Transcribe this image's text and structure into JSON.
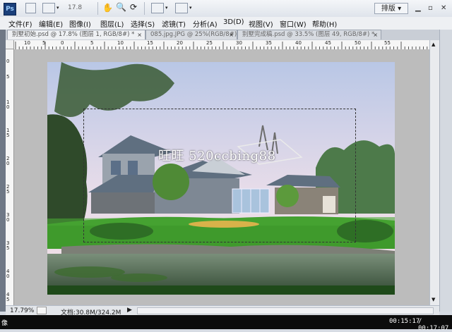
{
  "app": {
    "logo_text": "Ps",
    "zoom_value": "17.8",
    "layout_button": "排版"
  },
  "menu": [
    {
      "label": "文件(F)"
    },
    {
      "label": "编辑(E)"
    },
    {
      "label": "图像(I)"
    },
    {
      "label": "图层(L)"
    },
    {
      "label": "选择(S)"
    },
    {
      "label": "滤镜(T)"
    },
    {
      "label": "分析(A)"
    },
    {
      "label": "3D(D)"
    },
    {
      "label": "视图(V)"
    },
    {
      "label": "窗口(W)"
    },
    {
      "label": "帮助(H)"
    }
  ],
  "tabs": [
    {
      "label": "别墅初始.psd @ 17.8% (图层 1, RGB/8#) *",
      "close": "×"
    },
    {
      "label": "085.jpg.JPG @ 25%(RGB/8#)",
      "close": "×"
    },
    {
      "label": "别墅完成稿.psd @ 33.5% (图层 49, RGB/8#) *",
      "close": "×"
    }
  ],
  "ruler_h": [
    "10",
    "5",
    "0",
    "5",
    "10",
    "15",
    "20",
    "25",
    "30",
    "35",
    "40",
    "45",
    "50",
    "55"
  ],
  "ruler_v": [
    "0",
    "5",
    "10",
    "15",
    "20",
    "25",
    "30",
    "35",
    "40",
    "45"
  ],
  "watermark": "旺旺 520ccbing88",
  "status": {
    "zoom": "17.79%",
    "doc": "文档:30.8M/324.2M",
    "arrow": "▶"
  },
  "player": {
    "left_text": "像",
    "current_time": "00:15:17",
    "total_time": "/ 00:17:07"
  },
  "colors": {
    "sky_top": "#b9c7e6",
    "sky_bottom": "#f2dfe6",
    "lawn": "#3f9a2c",
    "roof": "#5f6f80",
    "water": "#5f7560"
  }
}
